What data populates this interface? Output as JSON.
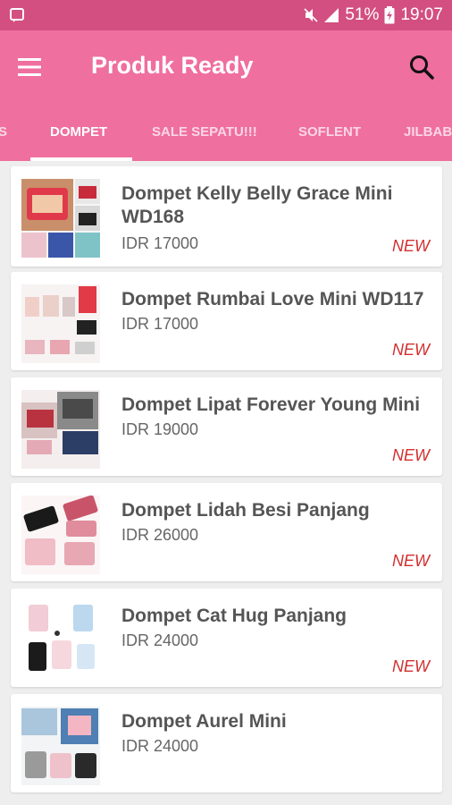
{
  "status_bar": {
    "battery_percent": "51%",
    "time": "19:07",
    "icons": [
      "notification-icon",
      "silent-mode-icon",
      "signal-icon",
      "battery-charging-icon"
    ]
  },
  "app_bar": {
    "title": "Produk Ready",
    "menu_icon": "hamburger-menu-icon",
    "search_icon": "search-icon"
  },
  "tabs": [
    {
      "label": "S",
      "active": false
    },
    {
      "label": "DOMPET",
      "active": true
    },
    {
      "label": "SALE SEPATU!!!",
      "active": false
    },
    {
      "label": "SOFLENT",
      "active": false
    },
    {
      "label": "JILBAB",
      "active": false
    }
  ],
  "products": [
    {
      "name": "Dompet Kelly Belly Grace Mini WD168",
      "price": "IDR 17000",
      "badge": "NEW",
      "thumb_icon": "wallet-thumbnail"
    },
    {
      "name": "Dompet Rumbai Love Mini WD117",
      "price": "IDR 17000",
      "badge": "NEW",
      "thumb_icon": "wallet-thumbnail"
    },
    {
      "name": "Dompet Lipat Forever Young Mini",
      "price": "IDR 19000",
      "badge": "NEW",
      "thumb_icon": "wallet-thumbnail"
    },
    {
      "name": "Dompet Lidah Besi Panjang",
      "price": "IDR 26000",
      "badge": "NEW",
      "thumb_icon": "wallet-thumbnail"
    },
    {
      "name": "Dompet Cat Hug Panjang",
      "price": "IDR 24000",
      "badge": "NEW",
      "thumb_icon": "wallet-thumbnail"
    },
    {
      "name": "Dompet Aurel Mini",
      "price": "IDR 24000",
      "badge": "",
      "thumb_icon": "wallet-thumbnail"
    }
  ],
  "colors": {
    "status_bar": "#d34f81",
    "app_bar": "#ef6f9e",
    "badge": "#d32f2f",
    "background": "#eeeeee"
  }
}
